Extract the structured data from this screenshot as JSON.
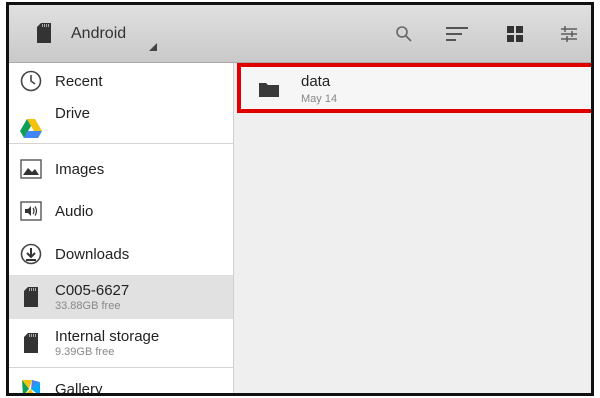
{
  "toolbar": {
    "title": "Android",
    "icons": [
      "sd-card-icon",
      "search-icon",
      "sort-icon",
      "grid-view-icon",
      "settings-sliders-icon"
    ]
  },
  "sidebar": {
    "items": [
      {
        "label": "Recent",
        "icon": "clock-icon"
      },
      {
        "label": "Drive",
        "icon": "drive-icon"
      },
      {
        "label": "Images",
        "icon": "image-icon"
      },
      {
        "label": "Audio",
        "icon": "audio-icon"
      },
      {
        "label": "Downloads",
        "icon": "download-icon"
      },
      {
        "label": "C005-6627",
        "sub": "33.88GB free",
        "icon": "sd-card-icon",
        "selected": true
      },
      {
        "label": "Internal storage",
        "sub": "9.39GB free",
        "icon": "sd-card-icon"
      },
      {
        "label": "Gallery",
        "icon": "gallery-icon"
      }
    ]
  },
  "main": {
    "files": [
      {
        "name": "data",
        "date": "May 14",
        "icon": "folder-icon",
        "highlighted": true
      }
    ]
  },
  "colors": {
    "highlight": "#e00000",
    "selected_bg": "#e1e1e1",
    "toolbar_bg": "#d4d4d4"
  }
}
